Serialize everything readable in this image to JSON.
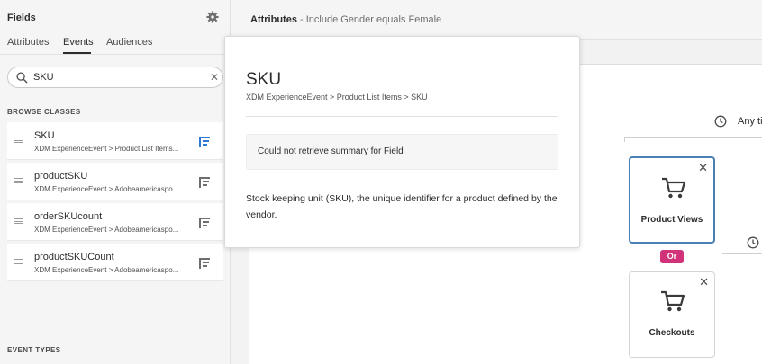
{
  "left_panel": {
    "title": "Fields",
    "tabs": [
      {
        "label": "Attributes"
      },
      {
        "label": "Events"
      },
      {
        "label": "Audiences"
      }
    ],
    "search": {
      "value": "SKU",
      "placeholder": ""
    },
    "browse_classes_label": "BROWSE CLASSES",
    "fields": [
      {
        "name": "SKU",
        "path": "XDM ExperienceEvent > Product List Items..."
      },
      {
        "name": "productSKU",
        "path": "XDM ExperienceEvent > Adobeamericaspo..."
      },
      {
        "name": "orderSKUcount",
        "path": "XDM ExperienceEvent > Adobeamericaspo..."
      },
      {
        "name": "productSKUCount",
        "path": "XDM ExperienceEvent > Adobeamericaspo..."
      }
    ],
    "event_types_label": "EVENT TYPES"
  },
  "main": {
    "header_title": "Attributes",
    "header_subtitle": "- Include Gender equals Female",
    "time_label": "Any ti",
    "events": [
      {
        "label": "Product Views",
        "close": "✕"
      },
      {
        "label": "Checkouts",
        "close": "✕"
      }
    ],
    "or_label": "Or"
  },
  "popover": {
    "title": "SKU",
    "path": "XDM ExperienceEvent > Product List Items > SKU",
    "notice": "Could not retrieve summary for Field",
    "description": "Stock keeping unit (SKU), the unique identifier for a product defined by the vendor."
  },
  "colors": {
    "accent_blue": "#4a7fb5",
    "or_badge": "#d1327a",
    "tree_icon_blue": "#2d7ad6"
  }
}
